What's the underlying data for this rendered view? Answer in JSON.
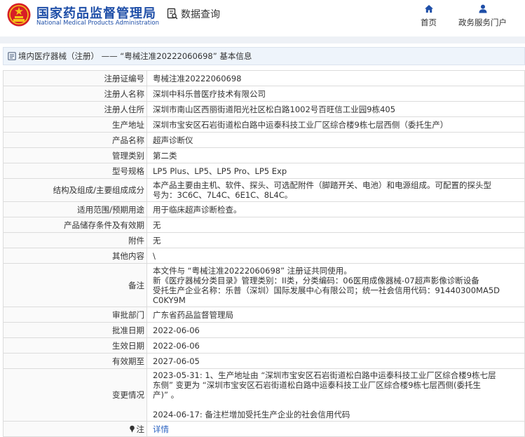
{
  "header": {
    "brand_cn": "国家药品监督管理局",
    "brand_en": "National Medical Products Administration",
    "page_title": "数据查询",
    "nav": {
      "home": "首页",
      "services": "政务服务门户"
    }
  },
  "breadcrumb": "境内医疗器械（注册） —— “粤械注准20222060698” 基本信息",
  "records": [
    {
      "label": "注册证编号",
      "value": "粤械注准20222060698"
    },
    {
      "label": "注册人名称",
      "value": "深圳中科乐普医疗技术有限公司"
    },
    {
      "label": "注册人住所",
      "value": "深圳市南山区西丽街道阳光社区松白路1002号百旺信工业园9栋405"
    },
    {
      "label": "生产地址",
      "value": "深圳市宝安区石岩街道松白路中运泰科技工业厂区综合楼9栋七层西侧（委托生产）"
    },
    {
      "label": "产品名称",
      "value": "超声诊断仪"
    },
    {
      "label": "管理类别",
      "value": "第二类"
    },
    {
      "label": "型号规格",
      "value": "LP5 Plus、LP5、LP5 Pro、LP5 Exp"
    },
    {
      "label": "结构及组成/主要组成成分",
      "lines": [
        "本产品主要由主机、软件、探头、可选配附件（脚踏开关、电池）和电源组成。可配置的探头型",
        "号为：3C6C、7L4C、6E1C、8L4C。"
      ]
    },
    {
      "label": "适用范围/预期用途",
      "value": "用于临床超声诊断检查。"
    },
    {
      "label": "产品储存条件及有效期",
      "value": "无"
    },
    {
      "label": "附件",
      "value": "无"
    },
    {
      "label": "其他内容",
      "value": "\\"
    },
    {
      "label": "备注",
      "lines": [
        "本文件与 “粤械注准20222060698” 注册证共同使用。",
        "新《医疗器械分类目录》管理类别：II类，分类编码：06医用成像器械-07超声影像诊断设备",
        "受托生产企业名称：乐普（深圳）国际发展中心有限公司；统一社会信用代码：91440300MA5D",
        "C0KY9M"
      ]
    },
    {
      "label": "审批部门",
      "value": "广东省药品监督管理局"
    },
    {
      "label": "批准日期",
      "value": "2022-06-06"
    },
    {
      "label": "生效日期",
      "value": "2022-06-06"
    },
    {
      "label": "有效期至",
      "value": "2027-06-05"
    },
    {
      "label": "变更情况",
      "lines": [
        "2023-05-31: 1、生产地址由 “深圳市宝安区石岩街道松白路中运泰科技工业厂区综合楼9栋七层",
        "东侧” 变更为 “深圳市宝安区石岩街道松白路中运泰科技工业厂区综合楼9栋七层西侧(委托生",
        "产)” 。",
        "",
        "2024-06-17: 备注栏增加受托生产企业的社会信用代码"
      ]
    }
  ],
  "note_row": {
    "label": "注",
    "link_text": "详情"
  },
  "colors": {
    "brand_blue": "#1f4fa8",
    "link_blue": "#2c64c2",
    "emblem_red": "#d71f26",
    "emblem_gold": "#f5c518"
  },
  "icons": [
    "national-emblem-icon",
    "search-doc-icon",
    "home-icon",
    "user-icon",
    "list-icon",
    "pin-icon"
  ]
}
